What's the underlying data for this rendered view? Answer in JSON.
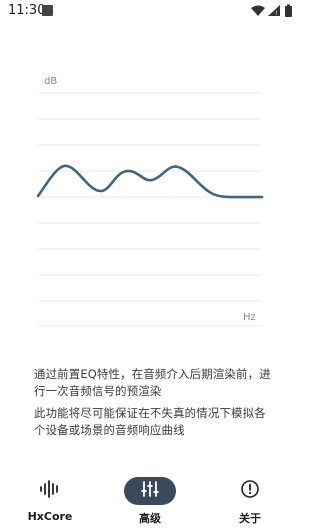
{
  "status_bar": {
    "time": "11:30"
  },
  "eq_graph": {
    "y_unit_label": "dB",
    "x_unit_label": "Hz",
    "curve_color": "#3f6585"
  },
  "description": {
    "line1": "通过前置EQ特性，在音频介入后期渲染前，进行一次音频信号的预渲染",
    "line2": "此功能将尽可能保证在不失真的情况下模拟各个设备或场景的音频响应曲线"
  },
  "nav": {
    "items": [
      {
        "label": "HxCore",
        "icon": "waveform-icon",
        "active": false
      },
      {
        "label": "高级",
        "icon": "equalizer-sliders-icon",
        "active": true
      },
      {
        "label": "关于",
        "icon": "info-icon",
        "active": false
      }
    ],
    "active_color": "#3b4a5a"
  }
}
